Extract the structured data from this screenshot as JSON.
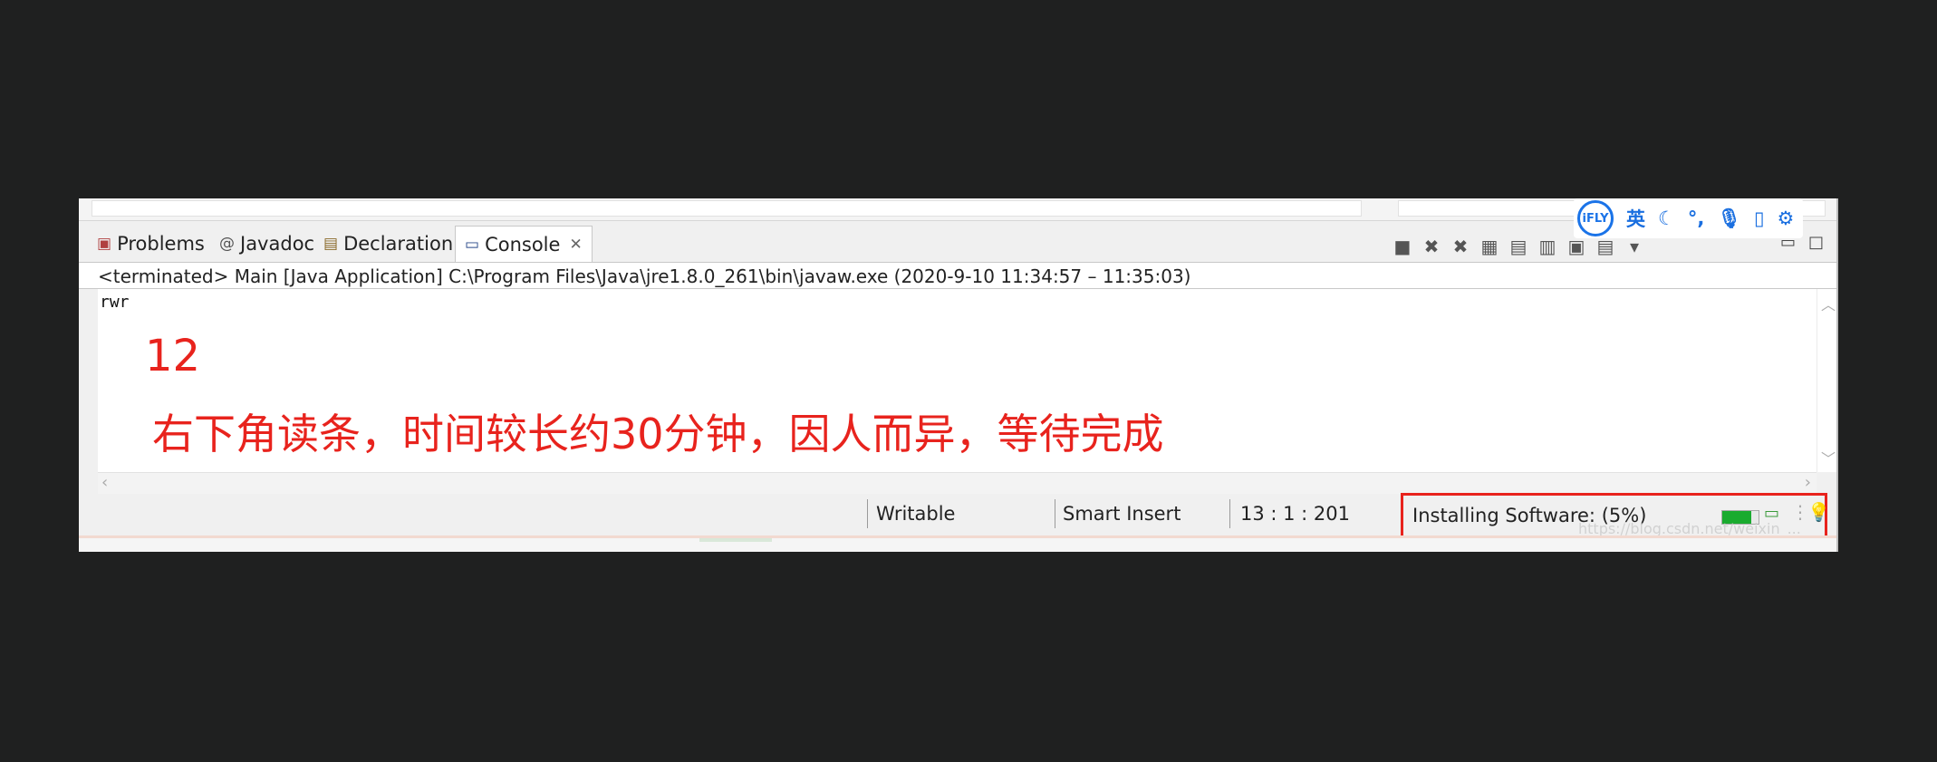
{
  "tabs": [
    {
      "label": "Problems",
      "icon": "problems-icon",
      "glyph": "▣"
    },
    {
      "label": "Javadoc",
      "icon": "javadoc-icon",
      "glyph": "@"
    },
    {
      "label": "Declaration",
      "icon": "declaration-icon",
      "glyph": "▤"
    },
    {
      "label": "Console",
      "icon": "console-icon",
      "glyph": "▭",
      "active": true
    }
  ],
  "ifly": {
    "logo": "iFLY",
    "lang": "英"
  },
  "console": {
    "header": "<terminated> Main [Java Application] C:\\Program Files\\Java\\jre1.8.0_261\\bin\\javaw.exe  (2020-9-10 11:34:57 – 11:35:03)",
    "output_line": "rwr",
    "annotation_number": "12",
    "annotation_text": "右下角读条，时间较长约30分钟，因人而异，等待完成"
  },
  "status": {
    "writable": "Writable",
    "insert_mode": "Smart Insert",
    "position": "13 : 1 : 201",
    "installing": "Installing Software: (5%)",
    "progress": 0.05
  },
  "watermark": "https://blog.csdn.net/weixin_...",
  "colors": {
    "annotation": "#e8231d",
    "progress": "#1aab2f",
    "ifly": "#1a73e8"
  }
}
